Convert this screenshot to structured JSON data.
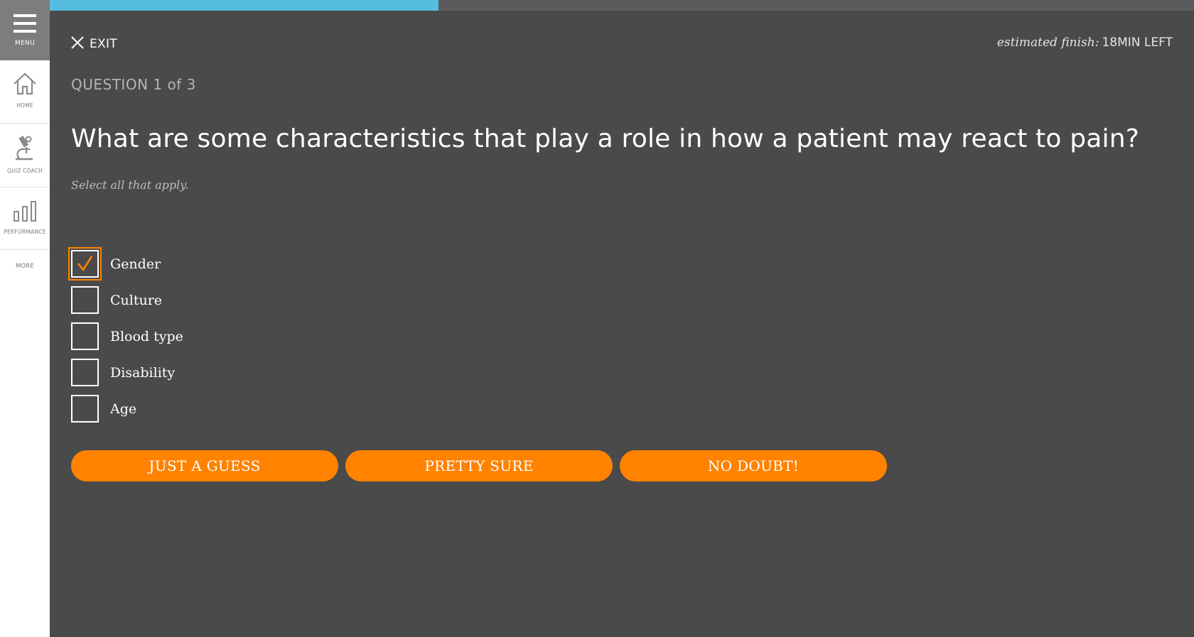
{
  "sidebar": {
    "menu_label": "MENU",
    "items": [
      {
        "label": "HOME",
        "icon": "home-icon"
      },
      {
        "label": "QUIZ COACH",
        "icon": "microscope-icon"
      },
      {
        "label": "PERFORMANCE",
        "icon": "bar-chart-icon"
      },
      {
        "label": "MORE"
      }
    ]
  },
  "progress": {
    "fraction": 0.34,
    "fill_color": "#55bde0",
    "track_color": "#5b5b5e"
  },
  "header": {
    "exit_label": "EXIT",
    "estimate_label": "estimated finish:",
    "estimate_value": "18MIN LEFT"
  },
  "question": {
    "count": "QUESTION 1 of 3",
    "text": "What are some characteristics that play a role in how a patient may react to pain?",
    "instruction": "Select all that apply."
  },
  "options": [
    {
      "label": "Gender",
      "checked": true
    },
    {
      "label": "Culture",
      "checked": false
    },
    {
      "label": "Blood type",
      "checked": false
    },
    {
      "label": "Disability",
      "checked": false
    },
    {
      "label": "Age",
      "checked": false
    }
  ],
  "confidence_buttons": [
    "JUST A GUESS",
    "PRETTY SURE",
    "NO DOUBT!"
  ],
  "colors": {
    "accent": "#ff8200",
    "background": "#4a4a4a",
    "sidebar": "#ffffff",
    "menu": "#7d7d7d"
  }
}
